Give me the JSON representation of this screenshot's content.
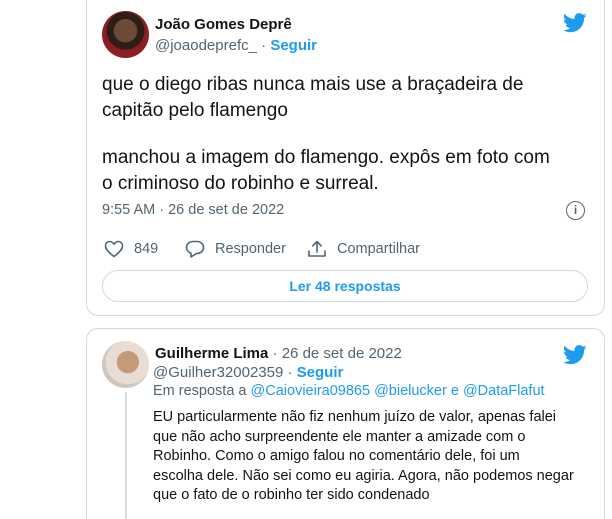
{
  "tweet": {
    "author_name": "João Gomes Deprê",
    "handle": "@joaodeprefc_",
    "separator": "·",
    "follow_label": "Seguir",
    "text_lines": [
      "que o diego ribas nunca mais use a braçadeira de",
      "capitão pelo flamengo",
      "manchou a imagem do flamengo. expôs em foto com",
      "o criminoso do robinho e surreal."
    ],
    "time": "9:55 AM",
    "date": "26 de set de 2022",
    "info_glyph": "i",
    "likes": "849",
    "reply_label": "Responder",
    "share_label": "Compartilhar",
    "read_replies_label": "Ler 48 respostas"
  },
  "reply": {
    "author_name": "Guilherme Lima",
    "date": "26 de set de 2022",
    "separator": "·",
    "handle": "@Guilher32002359",
    "follow_label": "Seguir",
    "in_reply_prefix": "Em resposta a",
    "in_reply_handles": "@Caiovieira09865 @bielucker e @DataFlafut",
    "text_lines": [
      "EU particularmente não fiz nenhum juízo de valor, apenas falei",
      "que não acho surpreendente ele manter a amizade com o",
      "Robinho. Como o amigo falou no comentário dele, foi um",
      "escolha dele. Não sei como eu agiria. Agora, não podemos negar",
      "que o fato de o robinho ter sido condenado"
    ]
  },
  "colors": {
    "accent": "#1d9bf0",
    "text": "#0f1419",
    "secondary": "#536471",
    "border": "#cfd9de"
  },
  "icons": [
    "twitter-bird-icon",
    "info-icon",
    "heart-icon",
    "reply-bubble-icon",
    "share-icon"
  ]
}
